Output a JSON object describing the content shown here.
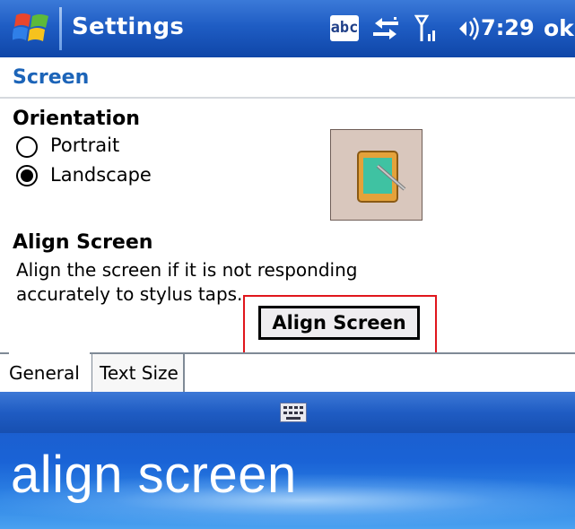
{
  "titlebar": {
    "app_title": "Settings",
    "abc_label": "abc",
    "clock": "7:29",
    "ok_label": "ok"
  },
  "header": {
    "title": "Screen"
  },
  "orientation": {
    "heading": "Orientation",
    "options": [
      {
        "label": "Portrait",
        "selected": false
      },
      {
        "label": "Landscape",
        "selected": true
      }
    ]
  },
  "align": {
    "heading": "Align Screen",
    "description": "Align the screen if it is not responding accurately to stylus taps.",
    "button_label": "Align Screen"
  },
  "tabs": [
    {
      "label": "General",
      "active": true
    },
    {
      "label": "Text Size",
      "active": false
    }
  ],
  "caption": "align screen",
  "colors": {
    "titlebar_blue": "#1f5dc4",
    "header_text": "#1c64b8",
    "highlight_red": "#e0161c"
  }
}
